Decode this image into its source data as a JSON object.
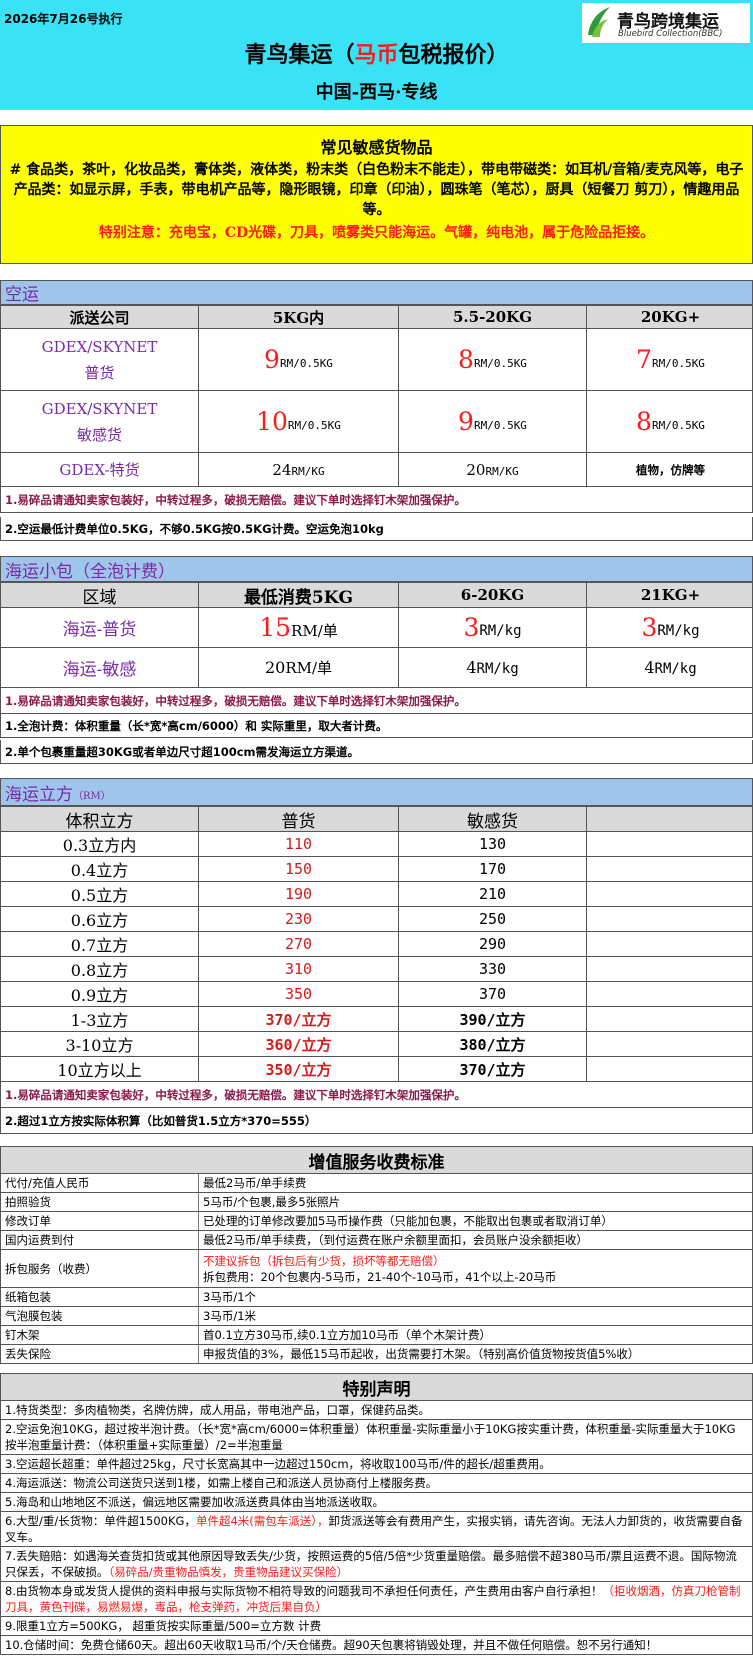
{
  "header": {
    "date": "2026年7月26号执行",
    "title_pre": "青鸟集运（",
    "title_red": "马币",
    "title_post": "包税报价）",
    "route": "中国-西马·专线",
    "logo_cn": "青鸟跨境集运",
    "logo_en": "Bluebird Collection(BBC)"
  },
  "sensitive": {
    "title": "常见敏感货物品",
    "text": "# 食品类，茶叶，化妆品类，膏体类，液体类，粉末类（白色粉末不能走），带电带磁类：如耳机/音箱/麦克风等，电子产品类：如显示屏，手表，带电机产品等，隐形眼镜，印章（印油），圆珠笔（笔芯），厨具（短餐刀 剪刀），情趣用品等。",
    "warning": "特别注意：充电宝，CD光碟，刀具，喷雾类只能海运。气罐，纯电池，属于危险品拒接。"
  },
  "air": {
    "section": "空运",
    "headers": [
      "派送公司",
      "5KG内",
      "5.5-20KG",
      "20KG+"
    ],
    "rows": [
      {
        "name_l1": "GDEX/SKYNET",
        "name_l2": "普货",
        "p1": "9",
        "u1": "RM/0.5KG",
        "p2": "8",
        "u2": "RM/0.5KG",
        "p3": "7",
        "u3": "RM/0.5KG"
      },
      {
        "name_l1": "GDEX/SKYNET",
        "name_l2": "敏感货",
        "p1": "10",
        "u1": "RM/0.5KG",
        "p2": "9",
        "u2": "RM/0.5KG",
        "p3": "8",
        "u3": "RM/0.5KG"
      },
      {
        "name_l1": "GDEX-特货",
        "p1": "24",
        "u1": "RM/KG",
        "p2": "20",
        "u2": "RM/KG",
        "p3_text": "植物，仿牌等"
      }
    ],
    "notes": [
      "1.易碎品请通知卖家包装好，中转过程多，破损无赔偿。建议下单时选择钉木架加强保护。",
      "2.空运最低计费单位0.5KG，不够0.5KG按0.5KG计费。空运免泡10kg"
    ]
  },
  "sea_small": {
    "section": "海运小包（全泡计费）",
    "headers": [
      "区域",
      "最低消费5KG",
      "6-20KG",
      "21KG+"
    ],
    "rows": [
      {
        "name": "海运-普货",
        "p1": "15",
        "u1": "RM/单",
        "p2": "3",
        "u2": "RM/kg",
        "p3": "3",
        "u3": "RM/kg"
      },
      {
        "name": "海运-敏感",
        "p1": "20",
        "u1": "RM/单",
        "p2": "4",
        "u2": "RM/kg",
        "p3": "4",
        "u3": "RM/kg"
      }
    ],
    "notes": [
      "1.易碎品请通知卖家包装好，中转过程多，破损无赔偿。建议下单时选择钉木架加强保护。",
      "1.全泡计费：体积重量（长*宽*高cm/6000）和 实际重里，取大者计费。",
      "2.单个包裹重量超30KG或者单边尺寸超100cm需发海运立方渠道。"
    ]
  },
  "sea_cube": {
    "section": "海运立方",
    "section_unit": "（RM）",
    "headers": [
      "体积立方",
      "普货",
      "敏感货",
      ""
    ],
    "rows": [
      [
        "0.3立方内",
        "110",
        "130"
      ],
      [
        "0.4立方",
        "150",
        "170"
      ],
      [
        "0.5立方",
        "190",
        "210"
      ],
      [
        "0.6立方",
        "230",
        "250"
      ],
      [
        "0.7立方",
        "270",
        "290"
      ],
      [
        "0.8立方",
        "310",
        "330"
      ],
      [
        "0.9立方",
        "350",
        "370"
      ],
      [
        "1-3立方",
        "370/立方",
        "390/立方"
      ],
      [
        "3-10立方",
        "360/立方",
        "380/立方"
      ],
      [
        "10立方以上",
        "350/立方",
        "370/立方"
      ]
    ],
    "notes": [
      "1.易碎品请通知卖家包装好，中转过程多，破损无赔偿。建议下单时选择钉木架加强保护。",
      "2.超过1立方按实际体积算（比如普货1.5立方*370=555）"
    ]
  },
  "services": {
    "title": "增值服务收费标准",
    "rows": [
      {
        "name": "代付/充值人民币",
        "desc": "最低2马币/单手续费"
      },
      {
        "name": "拍照验货",
        "desc": "5马币/个包裹,最多5张照片"
      },
      {
        "name": "修改订单",
        "desc": "已处理的订单修改要加5马币操作费（只能加包裹，不能取出包裹或者取消订单）"
      },
      {
        "name": "国内运费到付",
        "desc": "最低2马币/单手续费，（到付运费在账户余额里面扣，会员账户没余额拒收）"
      },
      {
        "name": "拆包服务（收费）",
        "desc_red": "不建议拆包（拆包后有少货，损坏等都无赔偿）",
        "desc": "拆包费用：20个包裹内-5马币，21-40个-10马币，41个以上-20马币"
      },
      {
        "name": "纸箱包装",
        "desc": "3马币/1个"
      },
      {
        "name": "气泡膜包装",
        "desc": "3马币/1米"
      },
      {
        "name": "钉木架",
        "desc": "首0.1立方30马币,续0.1立方加10马币（单个木架计费）"
      },
      {
        "name": "丢失保险",
        "desc": "申报货值的3%，最低15马币起收，出货需要打木架。（特别高价值货物按货值5%收）"
      }
    ]
  },
  "declaration": {
    "title": "特别声明",
    "items": [
      {
        "text": "1.特货类型：多肉植物类，名牌仿牌，成人用品，带电池产品，口罩，保健药品类。"
      },
      {
        "text": "2.空运免泡10KG，超过按半泡计费。（长*宽*高cm/6000=体积重量）体积重量-实际重量小于10KG按实重计费，体积重量-实际重量大于10KG按半泡重量计费：（体积重量+实际重量）/2=半泡重量"
      },
      {
        "text": "3.空运超长超重：单件超过25kg，尺寸长宽高其中一边超过150cm，将收取100马币/件的超长/超重费用。"
      },
      {
        "text": "4.海运派送：物流公司送货只送到1楼，如需上楼自己和派送人员协商付上楼服务费。"
      },
      {
        "text": "5.海岛和山地地区不派送，偏远地区需要加收派送费具体由当地派送收取。"
      },
      {
        "text_a": "6.大型/重/长货物：单件超1500KG，",
        "text_red": "单件超4米(需包车派送），",
        "text_b": "卸货派送等会有费用产生，实报实销，请先咨询。无法人力卸货的，收货需要自备叉车。"
      },
      {
        "text": "7.丢失赔赔：如遇海关查货扣货或其他原因导致丢失/少货，按照运费的5倍/5倍*少货重量赔偿。最多赔偿不超380马币/票且运费不退。国际物流只保丢，不保破损。",
        "text_red": "（易碎品/贵重物品慎发，贵重物品建议买保险）"
      },
      {
        "text": "8.由货物本身或发货人提供的资料申报与实际货物不相符导致的问题我司不承担任何责任，产生费用由客户自行承担！",
        "text_red": "（拒收烟酒，仿真刀枪管制刀具，黄色刊碟，易燃易爆，毒品，枪支弹药，冲货后果自负）"
      },
      {
        "text": "9.限重1立方=500KG，  超重货按实际重量/500=立方数 计费"
      },
      {
        "text": "10.仓储时间：免费仓储60天。超出60天收取1马币/个/天仓储费。超90天包裹将销毁处理，并且不做任何赔偿。恕不另行通知！"
      }
    ]
  },
  "colors": {
    "cyan": "#39e3f5",
    "yellow": "#ffff00",
    "blue": "#9fc5ea",
    "red": "#ff1a1a",
    "purple": "#7a2aa6"
  }
}
